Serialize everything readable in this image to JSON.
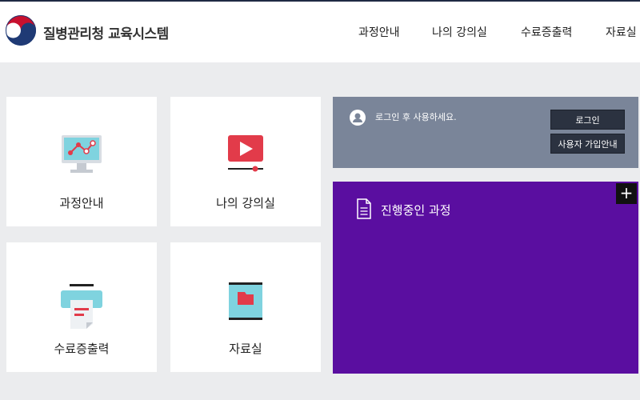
{
  "header": {
    "brand": "질병관리청 교육시스템",
    "logo_icon": "korea-government-emblem-icon"
  },
  "nav": {
    "items": [
      {
        "label": "과정안내"
      },
      {
        "label": "나의 강의실"
      },
      {
        "label": "수료증출력"
      },
      {
        "label": "자료실"
      }
    ]
  },
  "tiles": [
    {
      "label": "과정안내",
      "icon": "monitor-icon"
    },
    {
      "label": "나의 강의실",
      "icon": "video-play-icon"
    },
    {
      "label": "수료증출력",
      "icon": "printer-icon"
    },
    {
      "label": "자료실",
      "icon": "folder-icon"
    }
  ],
  "login": {
    "message": "로그인 후 사용하세요.",
    "login_button": "로그인",
    "signup_button": "사용자 가입안내",
    "user_icon": "user-icon"
  },
  "course": {
    "title": "진행중인 과정",
    "add_label": "+",
    "doc_icon": "document-icon"
  },
  "colors": {
    "login_panel": "#7a8599",
    "course_panel": "#5a0ea0",
    "button_dark": "#2b3240",
    "page_bg": "#ebecee"
  }
}
